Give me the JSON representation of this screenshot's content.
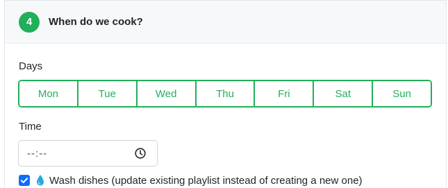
{
  "header": {
    "step_number": "4",
    "title": "When do we cook?"
  },
  "days": {
    "label": "Days",
    "options": [
      "Mon",
      "Tue",
      "Wed",
      "Thu",
      "Fri",
      "Sat",
      "Sun"
    ]
  },
  "time": {
    "label": "Time",
    "value": "--:--"
  },
  "wash_dishes": {
    "checked": true,
    "label": "Wash dishes (update existing playlist instead of creating a new one)"
  },
  "colors": {
    "accent_green": "#21b05a",
    "checkbox_blue": "#0d6efd",
    "drop_blue": "#29a8e0"
  },
  "icons": {
    "step": "step-number-badge",
    "time": "clock-icon",
    "check": "checkbox-checked-icon",
    "drop": "water-drop-icon"
  }
}
